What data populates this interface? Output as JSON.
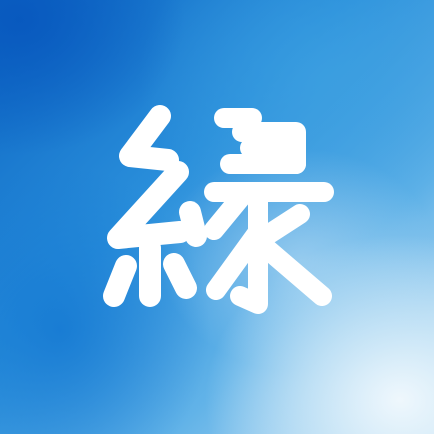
{
  "icon": {
    "glyph": "縁",
    "glyph_color": "#ffffff",
    "background_colors": [
      "#0c66c4",
      "#2a8fdb",
      "#62b3e8",
      "#c9e4f5",
      "#f0f8fd"
    ]
  }
}
